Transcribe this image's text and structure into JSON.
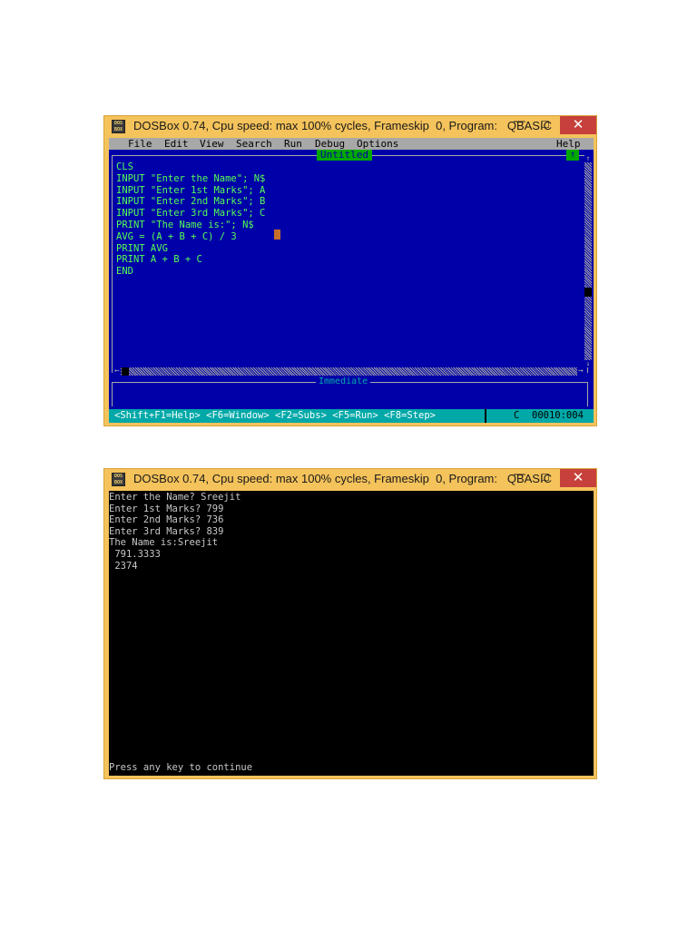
{
  "window1": {
    "title": "DOSBox 0.74, Cpu speed: max 100% cycles, Frameskip  0, Program:   QBASIC",
    "icon_label": "DOS BOX",
    "minimize": "—",
    "maximize": "☐",
    "close": "✕",
    "menu": [
      "File",
      "Edit",
      "View",
      "Search",
      "Run",
      "Debug",
      "Options"
    ],
    "help": "Help",
    "editor_title": "Untitled",
    "restore_glyph": "↑",
    "code": "CLS\nINPUT \"Enter the Name\"; N$\nINPUT \"Enter 1st Marks\"; A\nINPUT \"Enter 2nd Marks\"; B\nINPUT \"Enter 3rd Marks\"; C\nPRINT \"The Name is:\"; N$\nAVG = (A + B + C) / 3\nPRINT AVG\nPRINT A + B + C\nEND",
    "immediate_label": "Immediate",
    "status_help": "<Shift+F1=Help> <F6=Window> <F2=Subs> <F5=Run> <F8=Step>",
    "status_mode": "C",
    "status_pos": "00010:004",
    "scroll_up": "↑",
    "scroll_down": "↓",
    "scroll_left": "←",
    "scroll_right": "→"
  },
  "window2": {
    "title": "DOSBox 0.74, Cpu speed: max 100% cycles, Frameskip  0, Program:   QBASIC",
    "icon_label": "DOS BOX",
    "minimize": "—",
    "maximize": "☐",
    "close": "✕",
    "output": "Enter the Name? Sreejit\nEnter 1st Marks? 799\nEnter 2nd Marks? 736\nEnter 3rd Marks? 839\nThe Name is:Sreejit\n 791.3333\n 2374",
    "footer": "Press any key to continue"
  },
  "colors": {
    "window_frame": "#f5c35b",
    "close_button": "#c7403b",
    "qbasic_background": "#0000a8",
    "qbasic_code": "#55ff55",
    "status_bar": "#00a8a8"
  }
}
